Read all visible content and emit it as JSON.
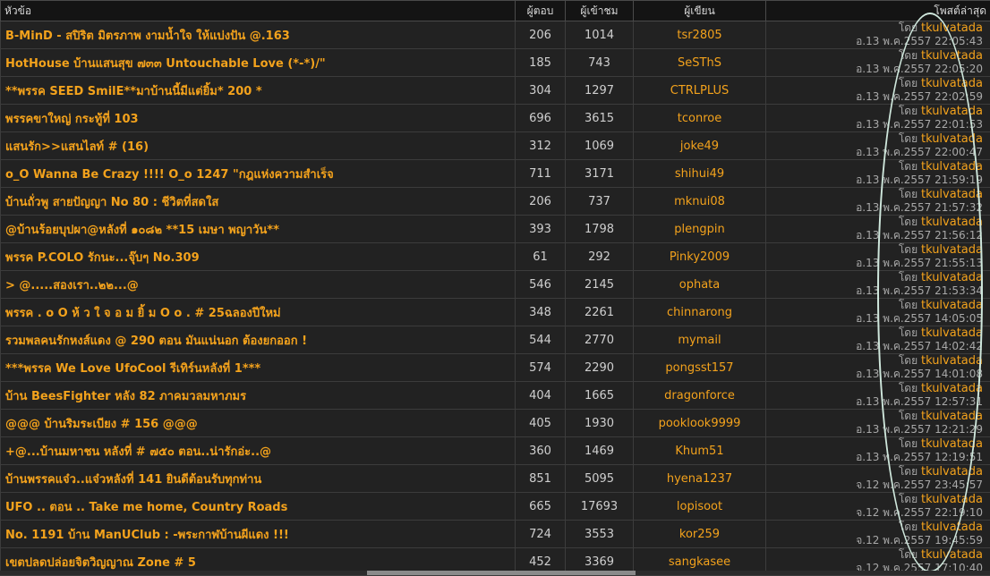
{
  "headers": {
    "topic": "หัวข้อ",
    "replies": "ผู้ตอบ",
    "views": "ผู้เข้าชม",
    "author": "ผู้เขียน",
    "last_post": "โพสต์ล่าสุด"
  },
  "by_prefix": "โดย",
  "colors": {
    "accent": "#f3a21c",
    "background": "#222222",
    "annotation": "#cfe7dc"
  },
  "rows": [
    {
      "topic": "B-MinD - สปิริต มิตรภาพ งามน้ำใจ ให้แบ่งปัน @.163",
      "replies": "206",
      "views": "1014",
      "author": "tsr2805",
      "last_by": "tkulvatada",
      "last_date": "อ.13 พ.ค.2557 22:05:43"
    },
    {
      "topic": "HotHouse บ้านแสนสุข ๗๓๓ Untouchable Love (*-*)/\"",
      "replies": "185",
      "views": "743",
      "author": "SeSThS",
      "last_by": "tkulvatada",
      "last_date": "อ.13 พ.ค.2557 22:05:20"
    },
    {
      "topic": "**พรรค SEED SmilE**มาบ้านนี้มีแต่ยิ้ม* 200 *",
      "replies": "304",
      "views": "1297",
      "author": "CTRLPLUS",
      "last_by": "tkulvatada",
      "last_date": "อ.13 พ.ค.2557 22:02:59"
    },
    {
      "topic": "พรรคขาใหญ่ กระทู้ที่ 103",
      "replies": "696",
      "views": "3615",
      "author": "tconroe",
      "last_by": "tkulvatada",
      "last_date": "อ.13 พ.ค.2557 22:01:53"
    },
    {
      "topic": "แสนรัก>>แสนไลท์ # (16)",
      "replies": "312",
      "views": "1069",
      "author": "joke49",
      "last_by": "tkulvatada",
      "last_date": "อ.13 พ.ค.2557 22:00:47"
    },
    {
      "topic": "o_O Wanna Be Crazy !!!! O_o 1247 \"กฎแห่งความสำเร็จ",
      "replies": "711",
      "views": "3171",
      "author": "shihui49",
      "last_by": "tkulvatada",
      "last_date": "อ.13 พ.ค.2557 21:59:19"
    },
    {
      "topic": "บ้านถั่วพู สายปัญญา No 80 : ชีวิตที่สดใส",
      "replies": "206",
      "views": "737",
      "author": "mknui08",
      "last_by": "tkulvatada",
      "last_date": "อ.13 พ.ค.2557 21:57:32"
    },
    {
      "topic": "@บ้านร้อยบุปผา@หลังที่ ๑๐๘๒ **15 เมษา พญาวัน**",
      "replies": "393",
      "views": "1798",
      "author": "plengpin",
      "last_by": "tkulvatada",
      "last_date": "อ.13 พ.ค.2557 21:56:12"
    },
    {
      "topic": "พรรค P.COLO รักนะ...จุ๊บๆ No.309",
      "replies": "61",
      "views": "292",
      "author": "Pinky2009",
      "last_by": "tkulvatada",
      "last_date": "อ.13 พ.ค.2557 21:55:13"
    },
    {
      "topic": "> @.....สองเรา..๒๒...@",
      "replies": "546",
      "views": "2145",
      "author": "ophata",
      "last_by": "tkulvatada",
      "last_date": "อ.13 พ.ค.2557 21:53:34"
    },
    {
      "topic": "พรรค . o O ห้ ว ใ จ อ ม ยิ้ ม O o . # 25ฉลองปีใหม่",
      "replies": "348",
      "views": "2261",
      "author": "chinnarong",
      "last_by": "tkulvatada",
      "last_date": "อ.13 พ.ค.2557 14:05:05"
    },
    {
      "topic": "รวมพลคนรักหงส์แดง @ 290 ตอน มันแน่นอก ต้องยกออก !",
      "replies": "544",
      "views": "2770",
      "author": "mymail",
      "last_by": "tkulvatada",
      "last_date": "อ.13 พ.ค.2557 14:02:42"
    },
    {
      "topic": "***พรรค We Love UfoCool รีเทิร์นหลังที่ 1***",
      "replies": "574",
      "views": "2290",
      "author": "pongsst157",
      "last_by": "tkulvatada",
      "last_date": "อ.13 พ.ค.2557 14:01:08"
    },
    {
      "topic": "บ้าน BeesFighter หลัง 82 ภาคมวลมหาภมร",
      "replies": "404",
      "views": "1665",
      "author": "dragonforce",
      "last_by": "tkulvatada",
      "last_date": "อ.13 พ.ค.2557 12:57:31"
    },
    {
      "topic": "@@@ บ้านริมระเบียง # 156 @@@",
      "replies": "405",
      "views": "1930",
      "author": "pooklook9999",
      "last_by": "tkulvatada",
      "last_date": "อ.13 พ.ค.2557 12:21:29"
    },
    {
      "topic": "+@...บ้านมหาชน หลังที่ # ๗๕๐ ตอน..น่ารักอ่ะ..@",
      "replies": "360",
      "views": "1469",
      "author": "Khum51",
      "last_by": "tkulvatada",
      "last_date": "อ.13 พ.ค.2557 12:19:51"
    },
    {
      "topic": "บ้านพรรคแจ๋ว..แจ๋วหลังที่ 141 ยินดีต้อนรับทุกท่าน",
      "replies": "851",
      "views": "5095",
      "author": "hyena1237",
      "last_by": "tkulvatada",
      "last_date": "จ.12 พ.ค.2557 23:45:57"
    },
    {
      "topic": "UFO .. ตอน .. Take me home, Country Roads",
      "replies": "665",
      "views": "17693",
      "author": "lopisoot",
      "last_by": "tkulvatada",
      "last_date": "จ.12 พ.ค.2557 22:19:10"
    },
    {
      "topic": "No. 1191 บ้าน ManUClub : -พระกาฬบ้านผีแดง !!!",
      "replies": "724",
      "views": "3553",
      "author": "kor259",
      "last_by": "tkulvatada",
      "last_date": "จ.12 พ.ค.2557 19:45:59"
    },
    {
      "topic": "เขตปลดปล่อยจิตวิญญาณ Zone # 5",
      "replies": "452",
      "views": "3369",
      "author": "sangkasee",
      "last_by": "tkulvatada",
      "last_date": "จ.12 พ.ค.2557 17:10:40"
    }
  ]
}
